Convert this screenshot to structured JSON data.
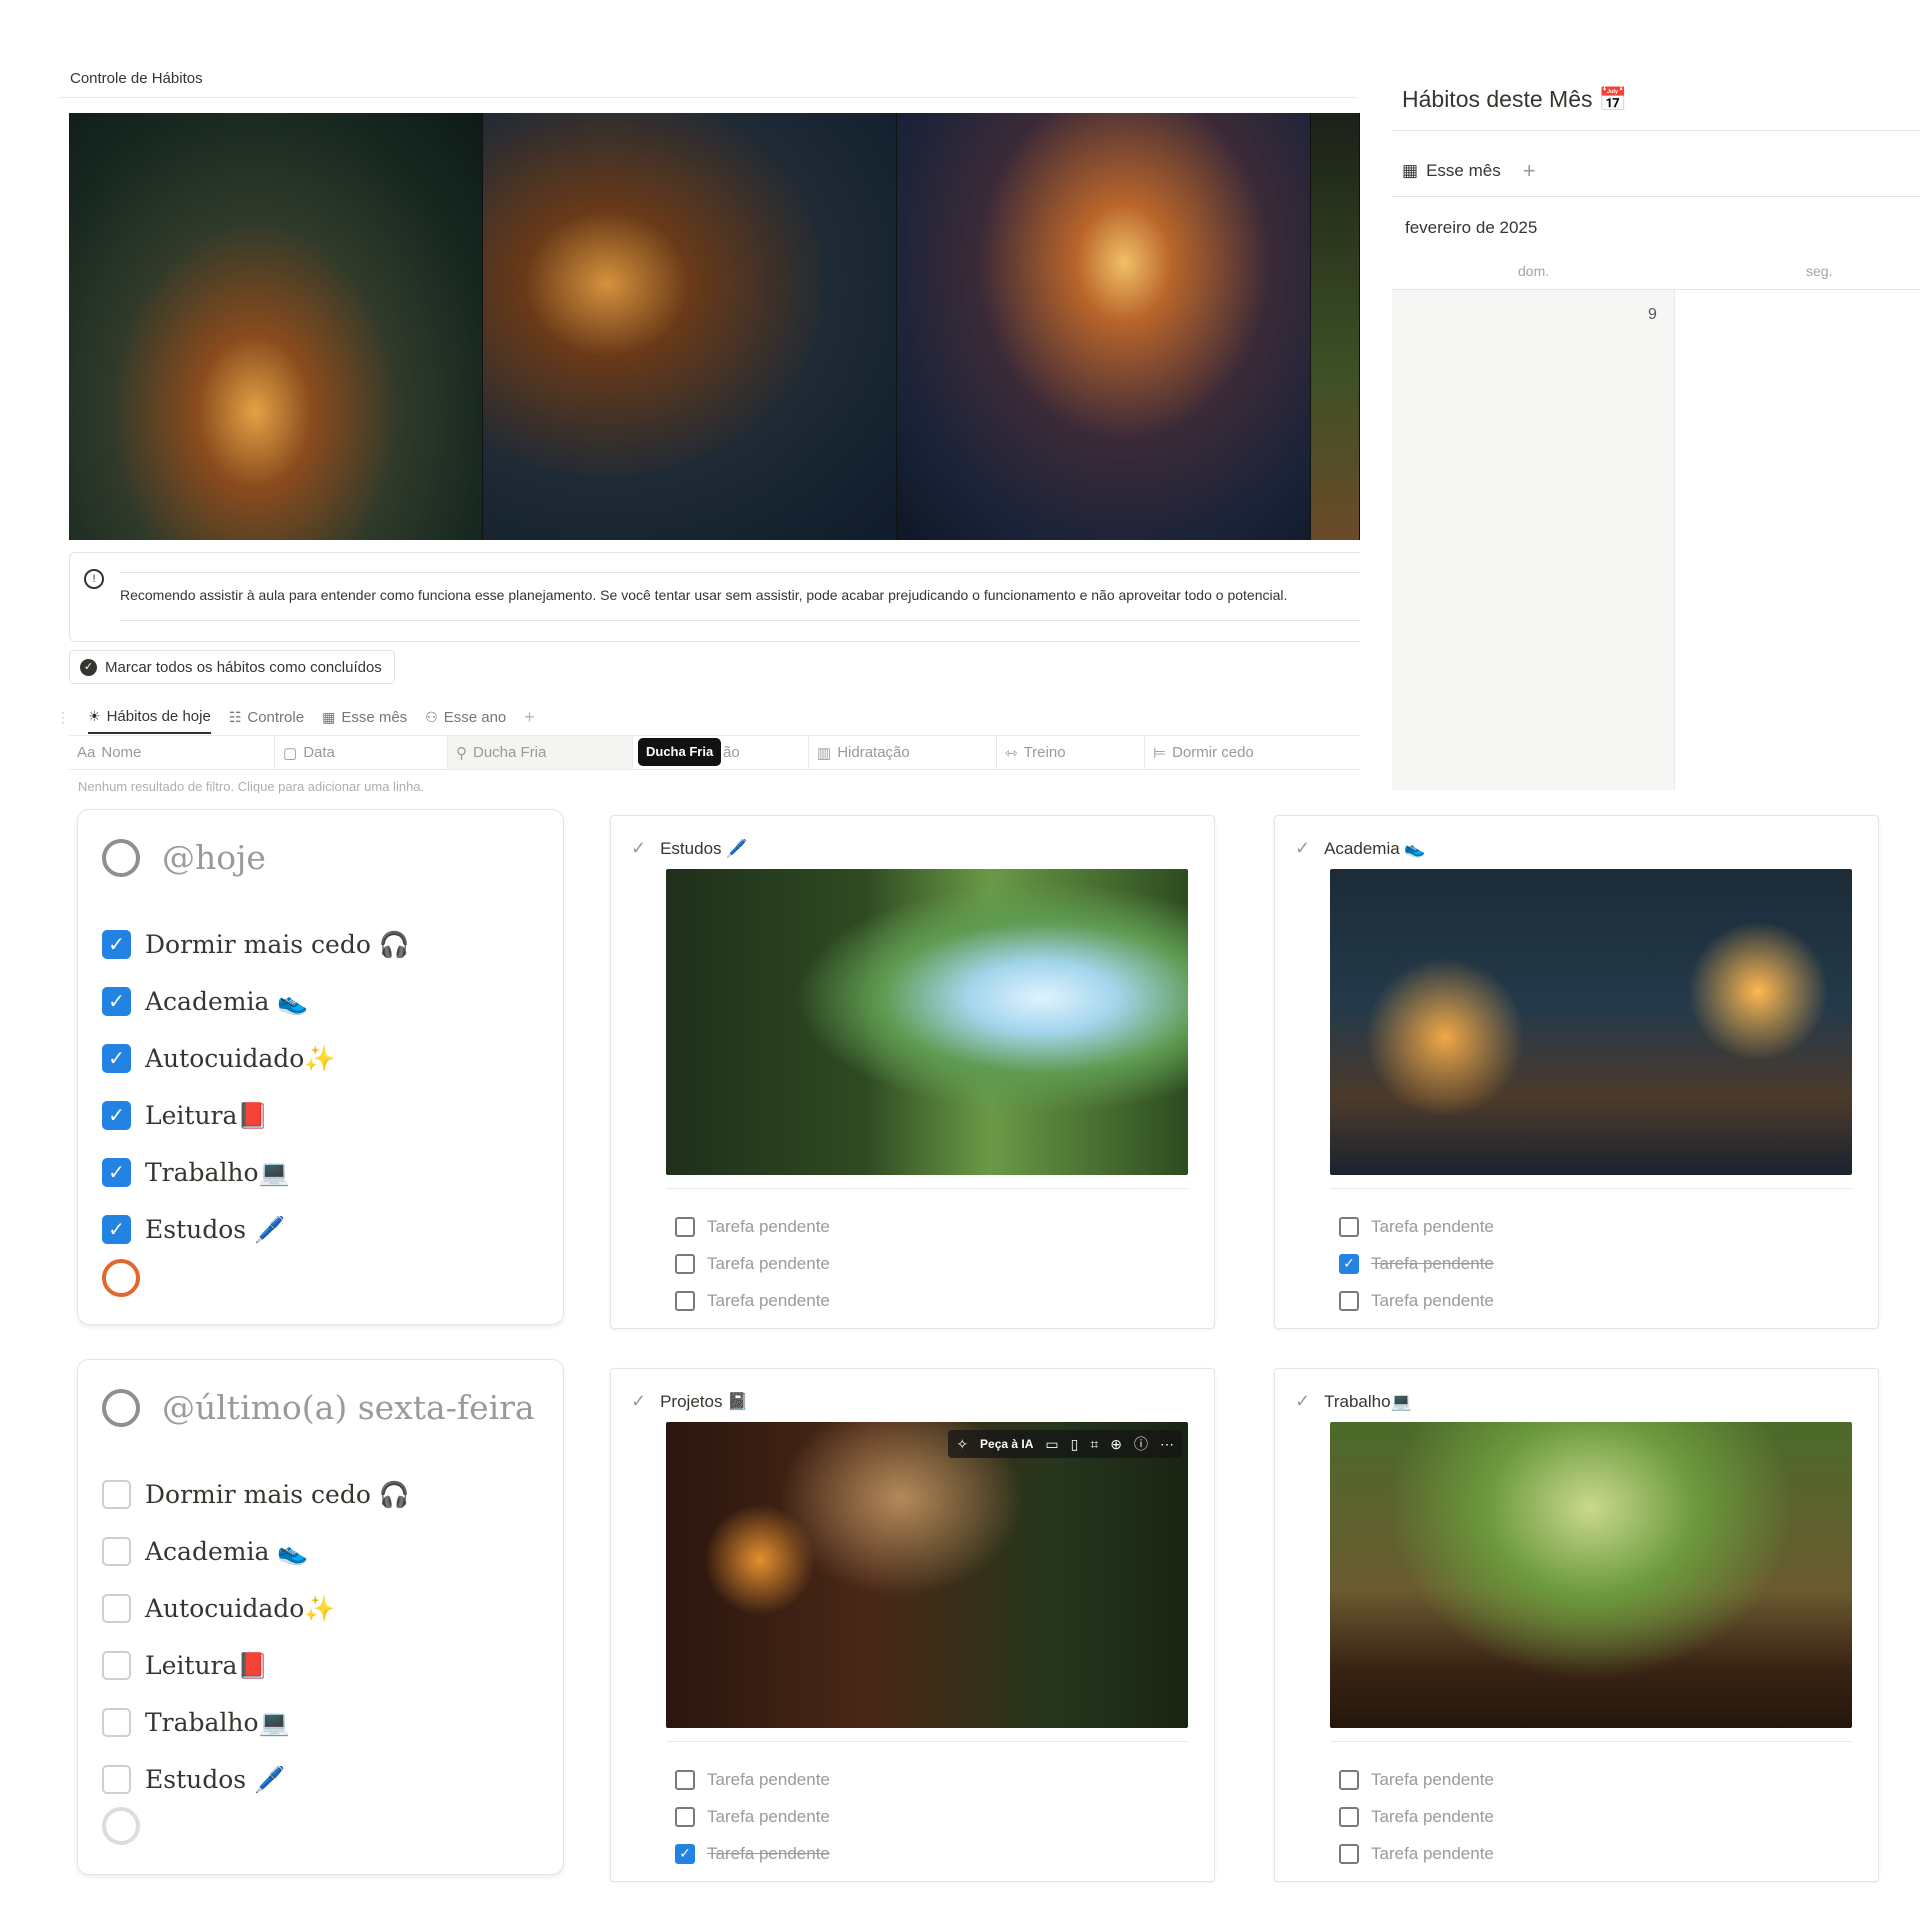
{
  "page": {
    "breadcrumb": "Controle de Hábitos",
    "callout_text": "Recomendo assistir à aula para entender como funciona esse planejamento. Se você tentar usar sem assistir, pode acabar prejudicando o funcionamento e não aproveitar todo o potencial.",
    "mark_all_button": "Marcar todos os hábitos como concluídos"
  },
  "views": [
    {
      "icon": "sun-icon",
      "glyph": "☀",
      "label": "Hábitos de hoje",
      "active": true
    },
    {
      "icon": "list-icon",
      "glyph": "☷",
      "label": "Controle"
    },
    {
      "icon": "calendar-icon",
      "glyph": "▦",
      "label": "Esse mês"
    },
    {
      "icon": "binoculars-icon",
      "glyph": "⚇",
      "label": "Esse ano"
    }
  ],
  "table": {
    "columns": [
      {
        "icon": "text-icon",
        "glyph": "Aa",
        "label": "Nome"
      },
      {
        "icon": "calendar-icon",
        "glyph": "▢",
        "label": "Data"
      },
      {
        "icon": "shower-icon",
        "glyph": "⚲",
        "label": "Ducha Fria"
      },
      {
        "icon": "checkbox-icon",
        "glyph": "",
        "label": "ão"
      },
      {
        "icon": "cup-icon",
        "glyph": "▥",
        "label": "Hidratação"
      },
      {
        "icon": "dumbbell-icon",
        "glyph": "⇿",
        "label": "Treino"
      },
      {
        "icon": "bed-icon",
        "glyph": "⊨",
        "label": "Dormir cedo"
      }
    ],
    "tooltip": "Ducha Fria",
    "empty_text": "Nenhum resultado de filtro. Clique para adicionar uma linha."
  },
  "calendar": {
    "title": "Hábitos deste Mês 📅",
    "view_tab": "Esse mês",
    "month": "fevereiro de 2025",
    "dow": [
      "dom.",
      "seg."
    ],
    "day": "9"
  },
  "habit_cards": [
    {
      "title": "@hoje",
      "items": [
        {
          "label": "Dormir mais cedo 🎧",
          "checked": true
        },
        {
          "label": "Academia 👟",
          "checked": true
        },
        {
          "label": "Autocuidado✨",
          "checked": true
        },
        {
          "label": "Leitura📕",
          "checked": true
        },
        {
          "label": "Trabalho💻",
          "checked": true
        },
        {
          "label": "Estudos 🖊️",
          "checked": true
        }
      ]
    },
    {
      "title": "@último(a) sexta-feira",
      "items": [
        {
          "label": "Dormir mais cedo 🎧",
          "checked": false
        },
        {
          "label": "Academia 👟",
          "checked": false
        },
        {
          "label": "Autocuidado✨",
          "checked": false
        },
        {
          "label": "Leitura📕",
          "checked": false
        },
        {
          "label": "Trabalho💻",
          "checked": false
        },
        {
          "label": "Estudos 🖊️",
          "checked": false
        }
      ]
    }
  ],
  "gallery": [
    {
      "title": "Estudos 🖊️",
      "tasks": [
        {
          "label": "Tarefa pendente",
          "checked": false
        },
        {
          "label": "Tarefa pendente",
          "checked": false
        },
        {
          "label": "Tarefa pendente",
          "checked": false
        }
      ]
    },
    {
      "title": "Academia 👟",
      "tasks": [
        {
          "label": "Tarefa pendente",
          "checked": false
        },
        {
          "label": "Tarefa pendente",
          "checked": true
        },
        {
          "label": "Tarefa pendente",
          "checked": false
        }
      ]
    },
    {
      "title": "Projetos 📓",
      "tasks": [
        {
          "label": "Tarefa pendente",
          "checked": false
        },
        {
          "label": "Tarefa pendente",
          "checked": false
        },
        {
          "label": "Tarefa pendente",
          "checked": true
        }
      ]
    },
    {
      "title": "Trabalho💻",
      "tasks": [
        {
          "label": "Tarefa pendente",
          "checked": false
        },
        {
          "label": "Tarefa pendente",
          "checked": false
        },
        {
          "label": "Tarefa pendente",
          "checked": false
        }
      ]
    }
  ],
  "image_toolbar": {
    "ask_ai": "Peça à IA",
    "icons": [
      "ai-sparkle-icon",
      "comment-icon",
      "caption-icon",
      "crop-icon",
      "zoom-icon",
      "info-icon",
      "more-icon"
    ]
  },
  "colors": {
    "accent_blue": "#2383e2",
    "ring_orange": "#e2672c",
    "text": "#37352f",
    "muted": "#9b9a97"
  }
}
